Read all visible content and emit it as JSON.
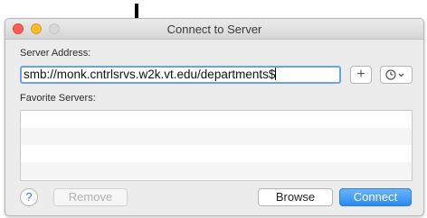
{
  "window": {
    "title": "Connect to Server"
  },
  "server_address": {
    "label": "Server Address:",
    "value": "smb://monk.cntrlsrvs.w2k.vt.edu/departments$"
  },
  "favorites": {
    "label": "Favorite Servers:",
    "items": []
  },
  "buttons": {
    "add": "+",
    "help": "?",
    "remove": "Remove",
    "browse": "Browse",
    "connect": "Connect"
  },
  "colors": {
    "accent": "#2a8bf2",
    "focus_ring": "#6aa2ea"
  }
}
